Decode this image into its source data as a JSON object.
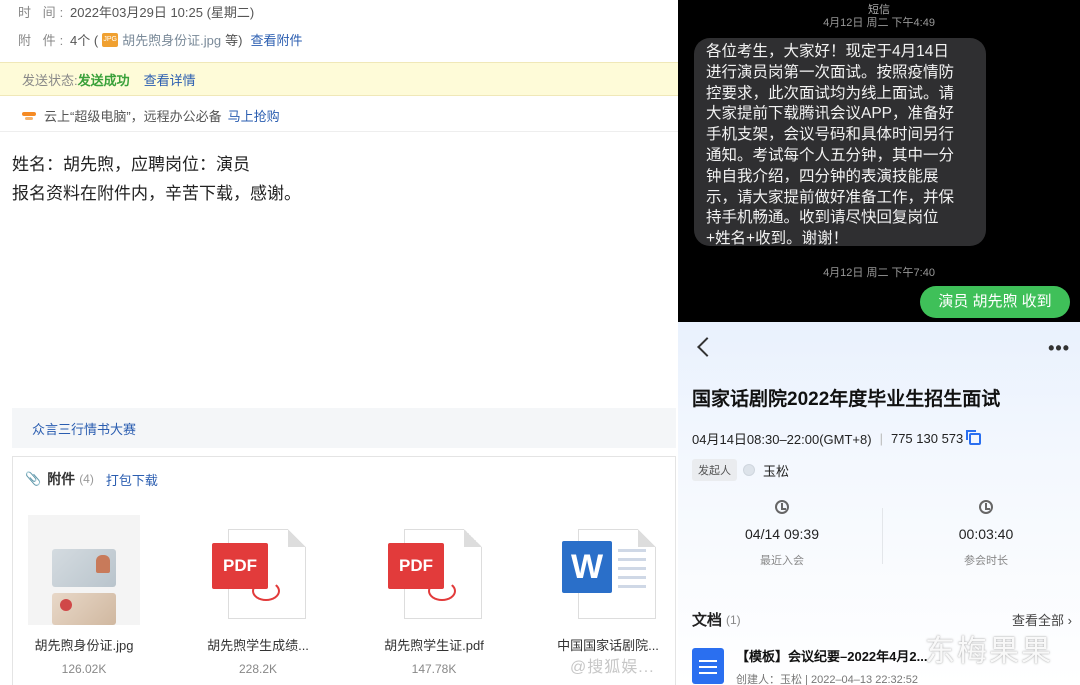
{
  "email": {
    "meta": {
      "time_label": "时  间:",
      "time_value": "2022年03月29日 10:25 (星期二)",
      "attach_label": "附  件:",
      "attach_count": "4个 (",
      "attach_first": "胡先煦身份证.jpg",
      "attach_suffix": "等)",
      "view_attachments": "查看附件"
    },
    "status": {
      "label": "发送状态:",
      "value": "发送成功",
      "details_link": "查看详情"
    },
    "ad": {
      "text": "云上“超级电脑”，远程办公必备",
      "link": "马上抢购"
    },
    "body_lines": [
      "姓名：胡先煦，应聘岗位：演员",
      "报名资料在附件内，辛苦下载，感谢。"
    ],
    "signature_link": "众言三行情书大赛",
    "attachments_section": {
      "title": "附件",
      "count": "(4)",
      "download_all": "打包下载",
      "files": [
        {
          "name": "胡先煦身份证.jpg",
          "size": "126.02K",
          "icon": "id-card-image"
        },
        {
          "name": "胡先煦学生成绩...",
          "size": "228.2K",
          "icon": "pdf-icon"
        },
        {
          "name": "胡先煦学生证.pdf",
          "size": "147.78K",
          "icon": "pdf-icon"
        },
        {
          "name": "中国国家话剧院...",
          "size": "",
          "icon": "word-icon"
        }
      ]
    },
    "pdf_label": "PDF",
    "word_label": "W",
    "weibo_watermark": "@搜狐娱..."
  },
  "sms": {
    "header": "短信",
    "timestamp_1": "4月12日 周二 下午4:49",
    "incoming_lines": [
      "各位考生，大家好！现定于4月14日",
      "进行演员岗第一次面试。按照疫情防",
      "控要求，此次面试均为线上面试。请",
      "大家提前下载腾讯会议APP，准备好",
      "手机支架，会议号码和具体时间另行",
      "通知。考试每个人五分钟，其中一分",
      "钟自我介绍，四分钟的表演技能展",
      "示，请大家提前做好准备工作，并保",
      "持手机畅通。收到请尽快回复岗位",
      "+姓名+收到。谢谢！"
    ],
    "timestamp_2": "4月12日 周二 下午7:40",
    "outgoing": "演员 胡先煦 收到"
  },
  "meeting": {
    "more": "•••",
    "title": "国家话剧院2022年度毕业生招生面试",
    "time": "04月14日08:30–22:00(GMT+8)",
    "meeting_id": "775 130 573",
    "host_tag": "发起人",
    "host_name": "玉松",
    "stats": [
      {
        "value": "04/14 09:39",
        "label": "最近入会",
        "icon": "history-icon"
      },
      {
        "value": "00:03:40",
        "label": "参会时长",
        "icon": "clock-icon"
      }
    ],
    "docs_title": "文档",
    "docs_count": "(1)",
    "view_all": "查看全部 ›",
    "doc": {
      "title": "【模板】会议纪要–2022年4月2...",
      "meta": "创建人：玉松 | 2022–04–13 22:32:52"
    }
  },
  "watermark": "东梅果果"
}
